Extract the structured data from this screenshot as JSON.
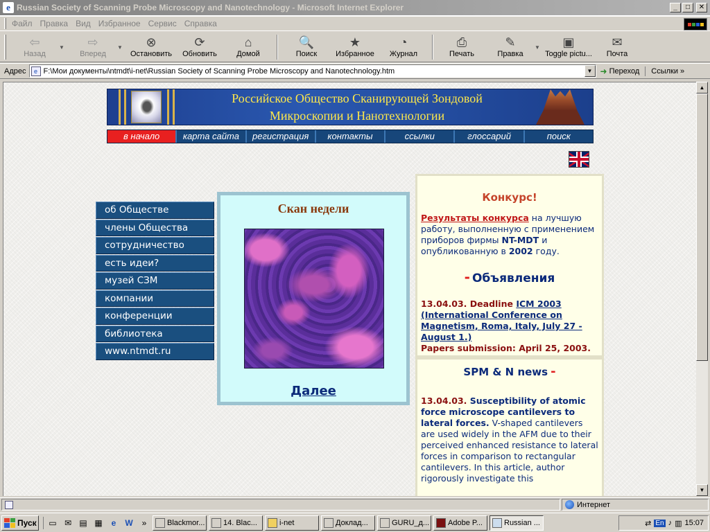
{
  "window": {
    "title": "Russian Society of Scanning Probe Microscopy and Nanotechnology - Microsoft Internet Explorer",
    "minimize": "_",
    "maximize": "□",
    "close": "✕"
  },
  "menu": [
    "Файл",
    "Правка",
    "Вид",
    "Избранное",
    "Сервис",
    "Справка"
  ],
  "toolbar": {
    "back": "Назад",
    "forward": "Вперед",
    "stop": "Остановить",
    "refresh": "Обновить",
    "home": "Домой",
    "search": "Поиск",
    "favorites": "Избранное",
    "history": "Журнал",
    "print": "Печать",
    "edit": "Правка",
    "toggle": "Toggle pictu...",
    "mail": "Почта"
  },
  "address": {
    "label": "Адрес",
    "value": "F:\\Мои документы\\ntmdt\\i-net\\Russian Society of Scanning Probe Microscopy and Nanotechnology.htm",
    "go": "Переход",
    "links": "Ссылки"
  },
  "page": {
    "banner": {
      "line1": "Российское Общество Сканирующей Зондовой",
      "line2": "Микроскопии и Нанотехнологии"
    },
    "nav": [
      "в начало",
      "карта сайта",
      "регистрация",
      "контакты",
      "ссылки",
      "глоссарий",
      "поиск"
    ],
    "leftnav": [
      "об Обществе",
      "члены Общества",
      "сотрудничество",
      "есть идеи?",
      "музей СЗМ",
      "компании",
      "конференции",
      "библиотека",
      "www.ntmdt.ru"
    ],
    "scan": {
      "title": "Скан недели",
      "more": "Далее"
    },
    "contest": {
      "title": "Конкурс!",
      "link": "Результаты конкурса",
      "text1": " на лучшую работу, выполненную с применением приборов фирмы ",
      "brand": "NT-MDT",
      "text2": " и опубликованную в ",
      "year": "2002",
      "text3": " году."
    },
    "ads": {
      "dash": "-",
      "title": "Объявления",
      "date": "13.04.03. Deadline ",
      "link": "ICM 2003 (International Conference on Magnetism, Roma, Italy, July 27 - August 1.)",
      "deadline": "Papers submission: April 25, 2003."
    },
    "news": {
      "title": "SPM & N news",
      "dash": "-",
      "date": "13.04.03.",
      "headline": " Susceptibility of atomic force microscope cantilevers to lateral forces.",
      "text": " V-shaped cantilevers are used widely in the AFM due to their perceived enhanced resistance to lateral forces in comparison to rectangular cantilevers. In this article, author rigorously investigate this"
    }
  },
  "status": {
    "zone": "Интернет"
  },
  "taskbar": {
    "start": "Пуск",
    "tasks": [
      "Blackmor...",
      "14. Blac...",
      "i-net",
      "Доклад...",
      "GURU_д...",
      "Adobe P...",
      "Russian ..."
    ],
    "lang": "En",
    "clock": "15:07"
  }
}
